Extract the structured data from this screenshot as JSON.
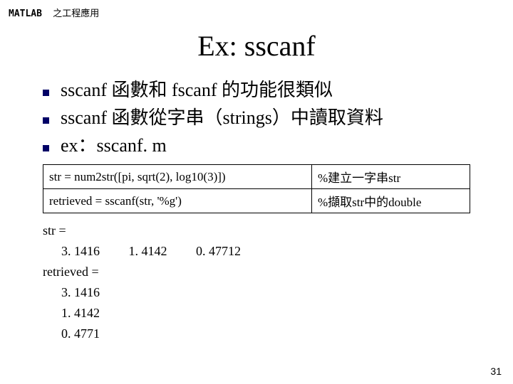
{
  "header": {
    "brand": "MATLAB",
    "subtitle": "之工程應用"
  },
  "title": "Ex: sscanf",
  "bullets": [
    "sscanf 函數和 fscanf 的功能很類似",
    "sscanf 函數從字串（strings）中讀取資料",
    "ex：sscanf. m"
  ],
  "code": {
    "rows": [
      {
        "left": "str = num2str([pi, sqrt(2), log10(3)])",
        "right": "%建立一字串str"
      },
      {
        "left": "retrieved = sscanf(str, '%g')",
        "right": "%擷取str中的double"
      }
    ]
  },
  "output": {
    "str_label": "str =",
    "str_values": [
      "3. 1416",
      "1. 4142",
      "0. 47712"
    ],
    "retrieved_label": "retrieved =",
    "retrieved_values": [
      "3. 1416",
      "1. 4142",
      "0. 4771"
    ]
  },
  "page_number": "31"
}
